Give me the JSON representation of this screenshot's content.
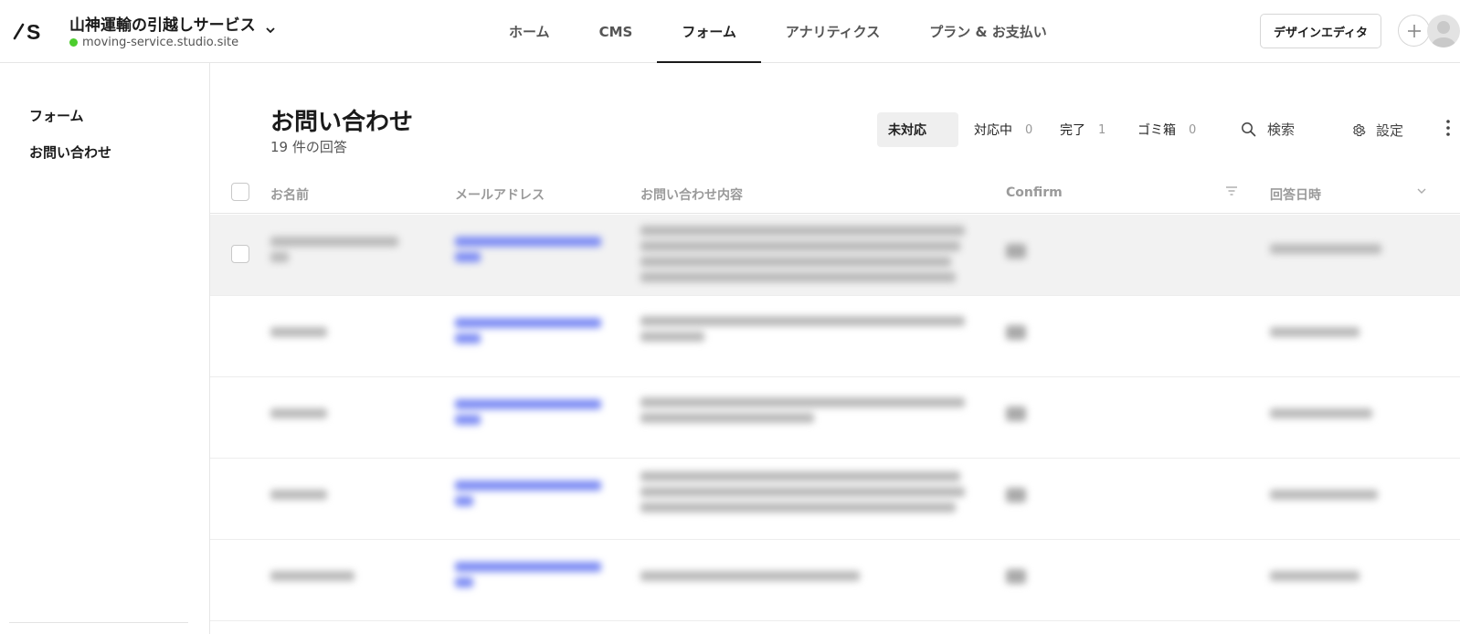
{
  "header": {
    "site_name": "山神運輸の引越しサービス",
    "site_url": "moving-service.studio.site",
    "nav": [
      {
        "label": "ホーム",
        "active": false
      },
      {
        "label": "CMS",
        "active": false
      },
      {
        "label": "フォーム",
        "active": true
      },
      {
        "label": "アナリティクス",
        "active": false
      },
      {
        "label": "プラン & お支払い",
        "active": false
      }
    ],
    "design_editor_label": "デザインエディタ",
    "status_color": "#4ccd2d"
  },
  "sidebar": {
    "items": [
      {
        "label": "フォーム"
      },
      {
        "label": "お問い合わせ"
      }
    ]
  },
  "main": {
    "title": "お問い合わせ",
    "response_count": "19 件の回答",
    "filters": [
      {
        "label": "未対応",
        "count": "",
        "active": true
      },
      {
        "label": "対応中",
        "count": "0",
        "active": false
      },
      {
        "label": "完了",
        "count": "1",
        "active": false
      },
      {
        "label": "ゴミ箱",
        "count": "0",
        "active": false
      }
    ],
    "search_label": "検索",
    "settings_label": "設定",
    "table": {
      "columns": [
        "お名前",
        "メールアドレス",
        "お問い合わせ内容",
        "Confirm",
        "回答日時"
      ]
    }
  }
}
